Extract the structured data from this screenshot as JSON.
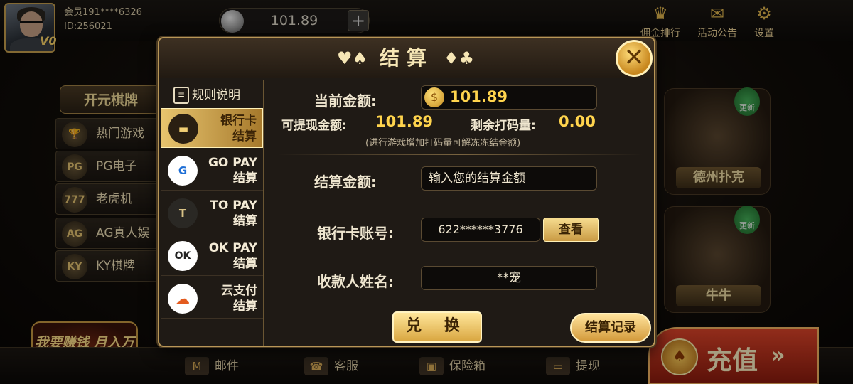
{
  "user": {
    "member_label": "会员191****6326",
    "id_label": "ID:256021",
    "vip": "V0"
  },
  "balance": {
    "value": "101.89",
    "plus": "+"
  },
  "top_icons": [
    {
      "label": "佣金排行",
      "icon": "trophy-icon"
    },
    {
      "label": "活动公告",
      "icon": "gift-icon"
    },
    {
      "label": "设置",
      "icon": "gear-icon"
    }
  ],
  "left_menu": {
    "brand": "开元棋牌",
    "items": [
      {
        "label": "热门游戏",
        "icon": "cup-icon",
        "glyph": "🏆"
      },
      {
        "label": "PG电子",
        "icon": "pg-icon",
        "glyph": "PG"
      },
      {
        "label": "老虎机",
        "icon": "slot-icon",
        "glyph": "777"
      },
      {
        "label": "AG真人娱",
        "icon": "dealer-icon",
        "glyph": "AG"
      },
      {
        "label": "KY棋牌",
        "icon": "ky-icon",
        "glyph": "KY"
      }
    ],
    "promo": "我要赚钱 月入万"
  },
  "tiles": [
    {
      "label": "德州扑克",
      "badge": "更新"
    },
    {
      "label": "牛牛",
      "badge": "更新"
    }
  ],
  "bottom_bar": [
    {
      "label": "邮件",
      "icon": "mail-icon",
      "glyph": "M"
    },
    {
      "label": "客服",
      "icon": "phone-icon",
      "glyph": "☎"
    },
    {
      "label": "保险箱",
      "icon": "safe-icon",
      "glyph": "▣"
    },
    {
      "label": "提现",
      "icon": "wallet-icon",
      "glyph": "▭"
    }
  ],
  "recharge": {
    "label": "充值",
    "arrow": "»",
    "glyph": "♠"
  },
  "dialog": {
    "title": "结算",
    "close": "✕",
    "rules_label": "规则说明",
    "tabs": [
      {
        "l1": "银行卡",
        "l2": "结算",
        "glyph": "▬",
        "selected": true,
        "icon": "bank-card-icon"
      },
      {
        "l1": "GO PAY",
        "l2": "结算",
        "glyph": "G",
        "selected": false,
        "icon": "gopay-icon"
      },
      {
        "l1": "TO PAY",
        "l2": "结算",
        "glyph": "T",
        "selected": false,
        "icon": "topay-icon"
      },
      {
        "l1": "OK PAY",
        "l2": "结算",
        "glyph": "OK",
        "selected": false,
        "icon": "okpay-icon"
      },
      {
        "l1": "云支付",
        "l2": "结算",
        "glyph": "☁",
        "selected": false,
        "icon": "cloud-pay-icon"
      }
    ],
    "current_amount_label": "当前金额:",
    "current_amount": "101.89",
    "withdrawable_label": "可提现金额:",
    "withdrawable": "101.89",
    "remaining_label": "剩余打码量:",
    "remaining": "0.00",
    "hint": "(进行游戏增加打码量可解冻冻结金额)",
    "settle_amount_label": "结算金额:",
    "settle_amount_placeholder": "输入您的结算金额",
    "card_label": "银行卡账号:",
    "card_value": "622******3776",
    "view_button": "查看",
    "payee_label": "收款人姓名:",
    "payee_value": "**宠",
    "exchange_button": "兑 换",
    "records_button": "结算记录"
  }
}
